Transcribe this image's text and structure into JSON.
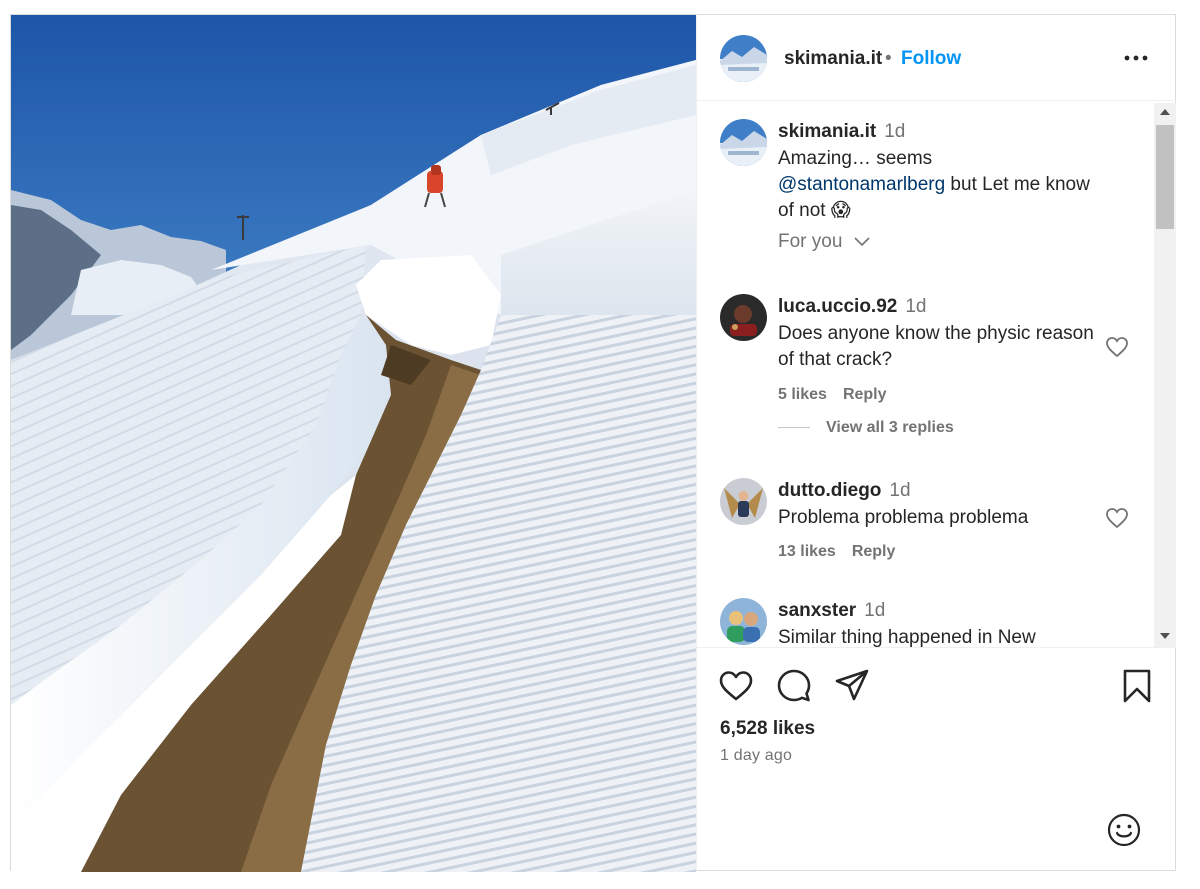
{
  "post": {
    "author": "skimania.it",
    "follow_label": "Follow",
    "separator": "•"
  },
  "caption": {
    "user": "skimania.it",
    "time": "1d",
    "text_before": "Amazing… seems ",
    "mention": "@stantonamarlberg",
    "text_after": " but Let me know of not 😱"
  },
  "filter": {
    "label": "For you"
  },
  "comments": [
    {
      "user": "luca.uccio.92",
      "time": "1d",
      "text": "Does anyone know the physic reason of that crack?",
      "likes": "5 likes",
      "reply_label": "Reply"
    },
    {
      "user": "dutto.diego",
      "time": "1d",
      "text": "Problema problema problema",
      "likes": "13 likes",
      "reply_label": "Reply"
    },
    {
      "user": "sanxster",
      "time": "1d",
      "text": "Similar thing happened in New Zealand this year. Big dump on"
    }
  ],
  "view_replies": "View all 3 replies",
  "stats": {
    "likes": "6,528 likes",
    "time_ago": "1 day ago"
  },
  "icons": {
    "more": "more-horizontal-icon",
    "like": "heart-icon",
    "comment": "comment-icon",
    "share": "send-icon",
    "save": "bookmark-icon",
    "emoji": "emoji-icon"
  },
  "colors": {
    "accent": "#0095f6",
    "mention": "#00376b",
    "secondary_text": "#737373",
    "primary_text": "#262626"
  }
}
